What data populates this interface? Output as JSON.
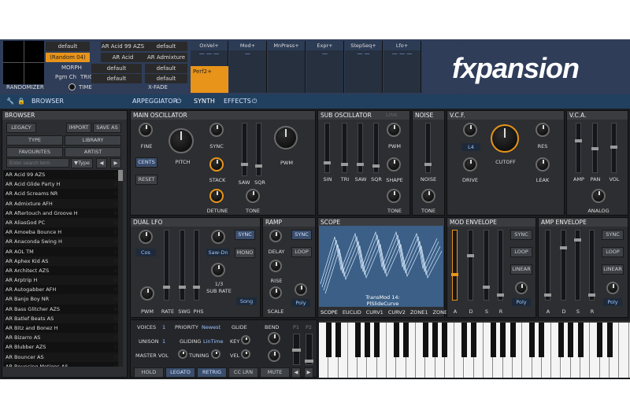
{
  "top": {
    "defaults": [
      "default",
      "default",
      "default",
      "default",
      "default",
      "default"
    ],
    "patches": [
      "AR Acid 99 AZS",
      "AR Acid Screams N",
      "AR Admixture AFH"
    ],
    "random": "(Random 04)",
    "morph": "MORPH",
    "pgm": "Pgm Ch",
    "trig": "TRIG",
    "randomizer": "RANDOMIZER",
    "time": "TIME",
    "xfade": "X-FADE",
    "macros": [
      "OnVel+",
      "Mod+",
      "MnPress+",
      "Expr+",
      "StepSeq+",
      "Lfo+"
    ],
    "perf": "Perf2+",
    "logo": "fxpansion"
  },
  "tabs": {
    "browser": "BROWSER",
    "arpeggiator": "ARPEGGIATOR",
    "synth": "SYNTH",
    "effects": "EFFECTS"
  },
  "browser": {
    "title": "BROWSER",
    "legacy": "LEGACY",
    "import": "IMPORT",
    "saveas": "SAVE AS",
    "type": "TYPE",
    "library": "LIBRARY",
    "favourites": "FAVOURITES",
    "artist": "ARTIST",
    "search_placeholder": "Enter search term",
    "type_filter": "▼Type",
    "items": [
      "AR Acid 99 AZS",
      "AR Acid Glide Party H",
      "AR Acid Screams NR",
      "AR Admixture AFH",
      "AR Aftertouch and Groove H",
      "AR AliasGod PC",
      "AR Amoeba Bounce H",
      "AR Anaconda Swing H",
      "AR AOL TM",
      "AR Aphex Kid AS",
      "AR Architect AZS",
      "AR Arptrip H",
      "AR Autogabber AFH",
      "AR Banjo Boy NR",
      "AR Bass Glitcher AZS",
      "AR Batlef Beats AS",
      "AR Bitz and Bonez H",
      "AR Bizarro AS",
      "AR Blubber AZS",
      "AR Bouncer AS",
      "AR Bouncing Motions AS"
    ]
  },
  "main_osc": {
    "title": "MAIN OSCILLATOR",
    "fine": "FINE",
    "pitch": "PITCH",
    "sync": "SYNC",
    "pwm": "PWM",
    "cents": "CENTS",
    "reset": "RESET",
    "stack": "STACK",
    "saw": "SAW",
    "sqr": "SQR",
    "detune": "DETUNE",
    "tone": "TONE"
  },
  "sub_osc": {
    "title": "SUB OSCILLATOR",
    "link": "LINK",
    "sin": "SIN",
    "tri": "TRI",
    "saw": "SAW",
    "sqr": "SQR",
    "pwm": "PWM",
    "shape": "SHAPE",
    "tone": "TONE"
  },
  "noise": {
    "title": "NOISE",
    "noise": "NOISE",
    "tone": "TONE"
  },
  "vcf": {
    "title": "V.C.F.",
    "mode": "L4",
    "cutoff": "CUTOFF",
    "drive": "DRIVE",
    "res": "RES",
    "leak": "LEAK"
  },
  "vca": {
    "title": "V.C.A.",
    "amp": "AMP",
    "pan": "PAN",
    "vol": "VOL",
    "analog": "ANALOG"
  },
  "lfo": {
    "title": "DUAL LFO",
    "cos": "Cos",
    "sawdn": "Saw-Dn",
    "sync": "SYNC",
    "mono": "MONO",
    "rate_val": "1/3",
    "subrate": "SUB RATE",
    "song": "Song",
    "pwm": "PWM",
    "rate": "RATE",
    "swg": "SWG",
    "phs": "PHS"
  },
  "ramp": {
    "title": "RAMP",
    "delay": "DELAY",
    "sync": "SYNC",
    "loop": "LOOP",
    "rise": "RISE",
    "scale": "SCALE",
    "poly": "Poly"
  },
  "scope": {
    "title": "SCOPE",
    "caption": "TransMod 14: PlSlideCurve",
    "tabs": [
      "SCOPE",
      "EUCLID",
      "CURV1",
      "CURV2",
      "ZONE1",
      "ZONE2"
    ]
  },
  "mod_env": {
    "title": "MOD ENVELOPE",
    "sync": "SYNC",
    "loop": "LOOP",
    "linear": "LINEAR",
    "poly": "Poly",
    "adsr": [
      "A",
      "D",
      "S",
      "R"
    ]
  },
  "amp_env": {
    "title": "AMP ENVELOPE",
    "sync": "SYNC",
    "loop": "LOOP",
    "linear": "LINEAR",
    "poly": "Poly",
    "adsr": [
      "A",
      "D",
      "S",
      "R"
    ]
  },
  "voice": {
    "voices": "VOICES",
    "voices_val": "1",
    "priority": "PRIORITY",
    "priority_val": "Newest",
    "glide": "GLIDE",
    "bend": "BEND",
    "unison": "UNISON",
    "unison_val": "1",
    "gliding": "GLIDING",
    "gliding_val": "LinTime",
    "key": "KEY",
    "master_vol": "MASTER VOL",
    "tuning": "TUNING",
    "vel": "VEL",
    "p1": "P1",
    "p2": "P2",
    "hold": "HOLD",
    "legato": "LEGATO",
    "retrig": "RETRIG",
    "cclrn": "CC LRN",
    "mute": "MUTE"
  }
}
